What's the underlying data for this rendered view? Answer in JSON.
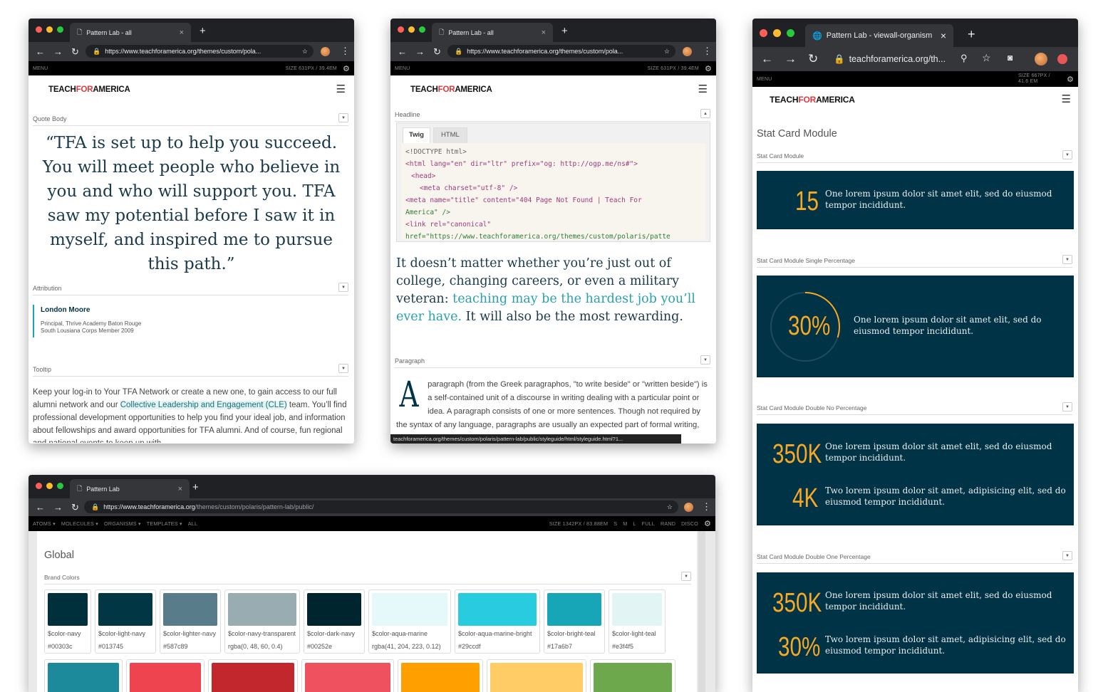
{
  "w1": {
    "tab_title": "Pattern Lab - all",
    "url": "https://www.teachforamerica.org/themes/custom/pola...",
    "pl_menu": "MENU",
    "pl_size": "SIZE  631PX / 39.4EM",
    "logo_a": "TEACH",
    "logo_b": "FOR",
    "logo_c": "AMERICA",
    "quote_label": "Quote Body",
    "quote": "“TFA is set up to help you succeed. You will meet people who believe in you and who will support you. TFA saw my potential before I saw it in myself, and inspired me to pursue this path.”",
    "attribution_label": "Attribution",
    "attr_name": "London Moore",
    "attr_line1": "Principal, Thrive Academy Baton Rouge",
    "attr_line2": "South Lousiana Corps Member 2009",
    "tooltip_label": "Tooltip",
    "tooltip_p1": "Keep your log-in to Your TFA Network or create a new one, to gain access to our full alumni network and our ",
    "tooltip_link": "Collective Leadership and Engagement (CLE)",
    "tooltip_p2": " team. You’ll find professional development opportunities to help you find your ideal job, and information about fellowships and award opportunities for TFA alumni. And of course, fun regional and national events to keep up with"
  },
  "w2": {
    "tab_title": "Pattern Lab - all",
    "url": "https://www.teachforamerica.org/themes/custom/pola...",
    "pl_menu": "MENU",
    "pl_size": "SIZE  631PX / 39.4EM",
    "headline_label": "Headline",
    "tab_twig": "Twig",
    "tab_html": "HTML",
    "code_lines": [
      "<!DOCTYPE html>",
      "<html lang=\"en\" dir=\"ltr\" prefix=\"og: http://ogp.me/ns#\">",
      "  <head>",
      "    <meta charset=\"utf-8\" />",
      "<meta name=\"title\" content=\"404 Page Not Found | Teach For",
      "America\" />",
      "<link rel=\"canonical\"",
      "href=\"https://www.teachforamerica.org/themes/custom/polaris/patte"
    ],
    "headline_a": "It doesn’t matter whether you’re just out of college, changing careers, or even a military veteran: ",
    "headline_link": "teaching may be the hardest job you’ll ever have.",
    "headline_b": " It will also be the most rewarding.",
    "paragraph_label": "Paragraph",
    "dropcap": "A",
    "paragraph": "paragraph (from the Greek paragraphos, \"to write beside\" or \"written beside\") is a self-contained unit of a discourse in writing dealing with a particular point or idea. A paragraph consists of one or more sentences. Though not required by the syntax of any language, paragraphs are usually an expected part of formal writing, used to organize longer prose. A",
    "status_url": "teachforamerica.org/themes/custom/polaris/pattern-lab/public/styleguide/html/styleguide.html?1..."
  },
  "w3": {
    "tab_title": "Pattern Lab - viewall-organism",
    "url": "teachforamerica.org/th...",
    "pl_menu": "MENU",
    "pl_size": "SIZE  667PX / 41.6 EM",
    "page_title": "Stat Card Module",
    "sections": [
      {
        "label": "Stat Card Module",
        "stats": [
          {
            "num": "15",
            "text": "One lorem ipsum dolor sit amet elit, sed do eiusmod tempor incididunt."
          }
        ]
      },
      {
        "label": "Stat Card Module Single Percentage",
        "stats": [
          {
            "num": "30%",
            "text": "One lorem ipsum dolor sit amet elit, sed do eiusmod tempor incididunt."
          }
        ]
      },
      {
        "label": "Stat Card Module Double No Percentage",
        "stats": [
          {
            "num": "350K",
            "text": "One lorem ipsum dolor sit amet elit, sed do eiusmod tempor incididunt."
          },
          {
            "num": "4K",
            "text": "Two lorem ipsum dolor sit amet, adipisicing elit, sed do eiusmod tempor incididunt."
          }
        ]
      },
      {
        "label": "Stat Card Module Double One Percentage",
        "stats": [
          {
            "num": "350K",
            "text": "One lorem ipsum dolor sit amet elit, sed do eiusmod tempor incididunt."
          },
          {
            "num": "30%",
            "text": "Two lorem ipsum dolor sit amet, adipisicing elit, sed do eiusmod tempor incididunt."
          }
        ]
      }
    ],
    "ring_percent": 0.3
  },
  "w4": {
    "tab_title": "Pattern Lab",
    "url_a": "https://www.teachforamerica.org",
    "url_b": "/themes/custom/polaris/pattern-lab/public/",
    "nav": [
      "ATOMS ▾",
      "MOLECULES ▾",
      "ORGANISMS ▾",
      "TEMPLATES ▾",
      "ALL"
    ],
    "size": "SIZE  1342PX / 83.88EM",
    "size_buttons": [
      "S",
      "M",
      "L",
      "FULL",
      "RAND",
      "DISCO"
    ],
    "page_title": "Global",
    "brand_label": "Brand Colors",
    "swatches": [
      {
        "name": "$color-navy",
        "value": "#00303c",
        "color": "#00303c"
      },
      {
        "name": "$color-light-navy",
        "value": "#013745",
        "color": "#013745"
      },
      {
        "name": "$color-lighter-navy",
        "value": "#587c89",
        "color": "#587c89"
      },
      {
        "name": "$color-navy-transparent",
        "value": "rgba(0, 48, 60, 0.4)",
        "color": "rgba(0,48,60,0.4)"
      },
      {
        "name": "$color-dark-navy",
        "value": "#00252e",
        "color": "#00252e"
      },
      {
        "name": "$color-aqua-marine",
        "value": "rgba(41, 204, 223, 0.12)",
        "color": "rgba(41,204,223,0.12)"
      },
      {
        "name": "$color-aqua-marine-bright",
        "value": "#29ccdf",
        "color": "#29ccdf"
      },
      {
        "name": "$color-bright-teal",
        "value": "#17a6b7",
        "color": "#17a6b7"
      },
      {
        "name": "$color-light-teal",
        "value": "#e3f4f5",
        "color": "#e3f4f5"
      }
    ],
    "row2_colors": [
      "#1d8a9b",
      "#ee4450",
      "#c1272d",
      "#f0515e",
      "#ffa000",
      "#ffcc66",
      "#6ea84c"
    ]
  }
}
